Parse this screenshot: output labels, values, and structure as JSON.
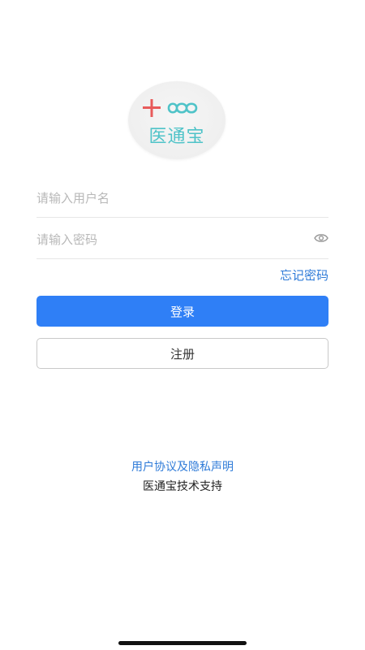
{
  "app": {
    "logo_text": "医通宝"
  },
  "login_form": {
    "username_placeholder": "请输入用户名",
    "username_value": "",
    "password_placeholder": "请输入密码",
    "password_value": "",
    "forgot_password_label": "忘记密码",
    "login_button_label": "登录",
    "register_button_label": "注册"
  },
  "footer": {
    "agreement_link": "用户协议及隐私声明",
    "support_text": "医通宝技术支持"
  },
  "icons": {
    "logo_plus": "plus-icon",
    "logo_infinity": "infinity-icon",
    "password_visibility": "eye-icon"
  },
  "colors": {
    "primary": "#2f7ff6",
    "link": "#2f7bd8",
    "logo_teal": "#4fc3c8",
    "logo_red": "#e85b5b"
  }
}
